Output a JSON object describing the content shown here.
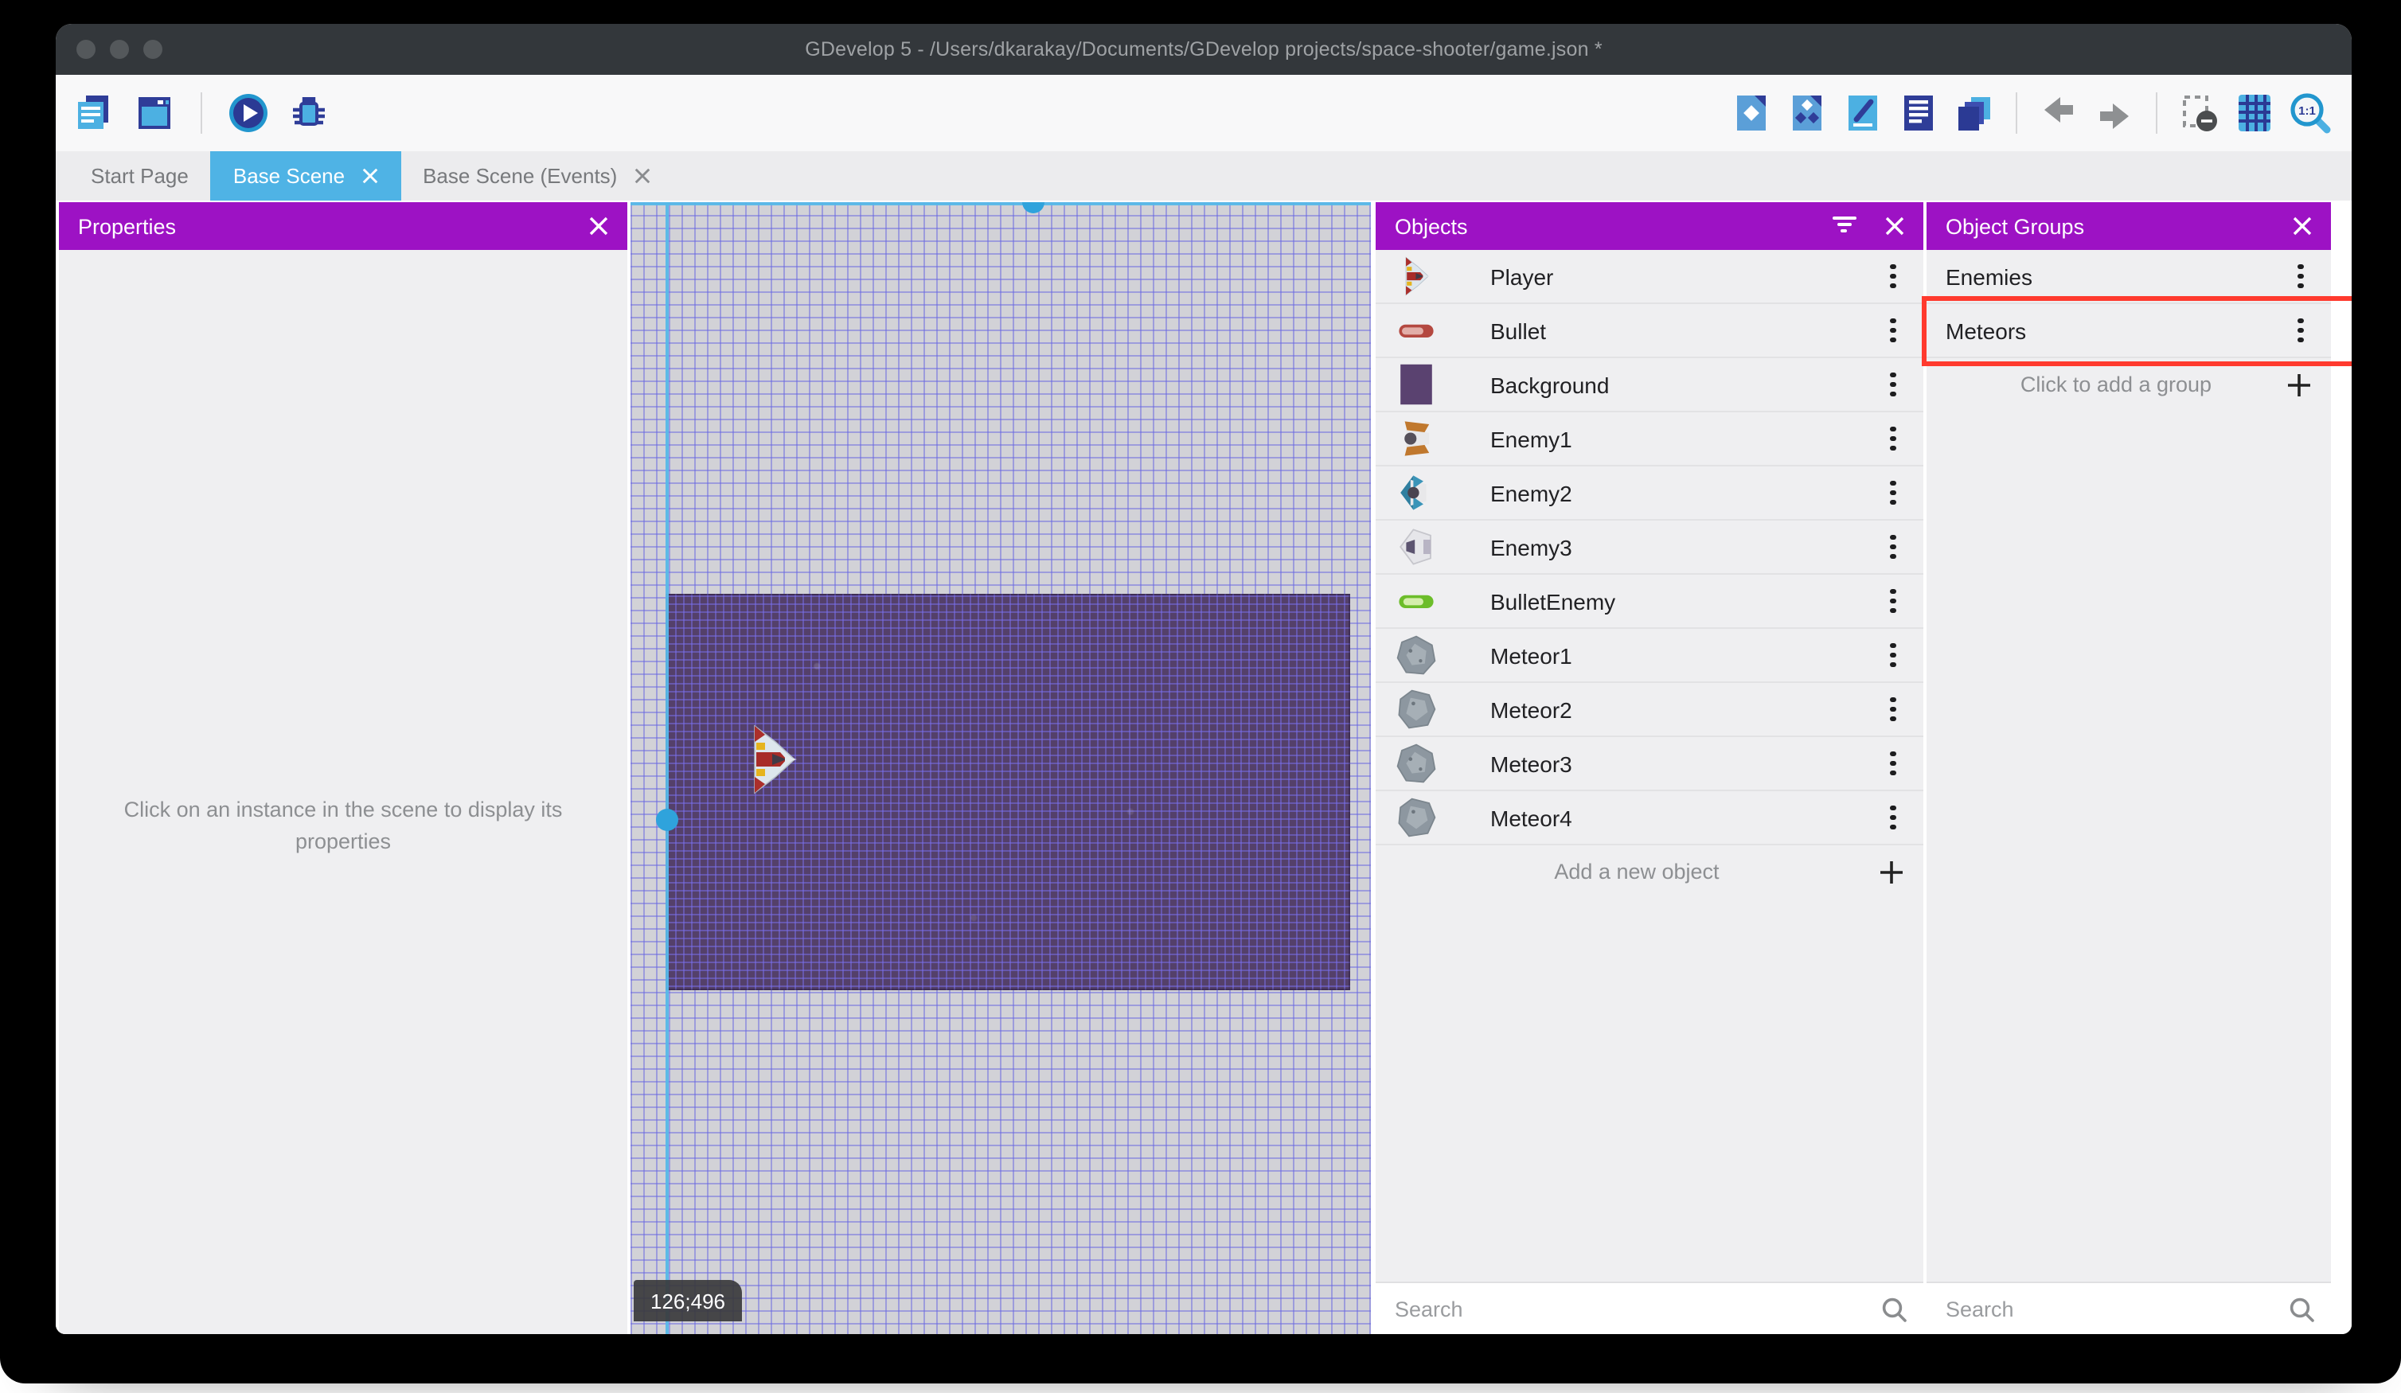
{
  "window": {
    "title": "GDevelop 5 - /Users/dkarakay/Documents/GDevelop projects/space-shooter/game.json *"
  },
  "toolbar": {
    "left_icons": [
      "project-manager-icon",
      "scene-editor-icon",
      "preview-play-icon",
      "debug-icon"
    ],
    "right_icons": [
      "objects-panel-icon",
      "object-groups-panel-icon",
      "properties-panel-icon",
      "instances-list-icon",
      "layers-panel-icon",
      "undo-icon",
      "redo-icon",
      "toggle-instances-visibility-icon",
      "grid-icon",
      "zoom-one-to-one-icon"
    ]
  },
  "tabs": [
    {
      "label": "Start Page",
      "active": false,
      "closable": false
    },
    {
      "label": "Base Scene",
      "active": true,
      "closable": true
    },
    {
      "label": "Base Scene (Events)",
      "active": false,
      "closable": true
    }
  ],
  "properties_panel": {
    "title": "Properties",
    "empty_message": "Click on an instance in the scene to display its properties"
  },
  "objects_panel": {
    "title": "Objects",
    "items": [
      {
        "name": "Player",
        "icon": "#sym-player"
      },
      {
        "name": "Bullet",
        "icon": "#sym-bullet-red"
      },
      {
        "name": "Background",
        "icon": "#sym-background"
      },
      {
        "name": "Enemy1",
        "icon": "#sym-enemy1"
      },
      {
        "name": "Enemy2",
        "icon": "#sym-enemy2"
      },
      {
        "name": "Enemy3",
        "icon": "#sym-enemy3"
      },
      {
        "name": "BulletEnemy",
        "icon": "#sym-bullet-green"
      },
      {
        "name": "Meteor1",
        "icon": "#sym-meteor-a"
      },
      {
        "name": "Meteor2",
        "icon": "#sym-meteor-b"
      },
      {
        "name": "Meteor3",
        "icon": "#sym-meteor-a"
      },
      {
        "name": "Meteor4",
        "icon": "#sym-meteor-b"
      }
    ],
    "add_label": "Add a new object",
    "search_placeholder": "Search"
  },
  "groups_panel": {
    "title": "Object Groups",
    "items": [
      {
        "name": "Enemies",
        "highlighted": false
      },
      {
        "name": "Meteors",
        "highlighted": true
      }
    ],
    "add_label": "Click to add a group",
    "search_placeholder": "Search"
  },
  "canvas": {
    "coordinate_badge": "126;496"
  },
  "colors": {
    "accent_purple": "#9d12c4",
    "active_tab_blue": "#4FB3E5",
    "selection_blue": "#56b8e8",
    "highlight_red": "#ff3a2e",
    "titlebar": "#33373b"
  }
}
